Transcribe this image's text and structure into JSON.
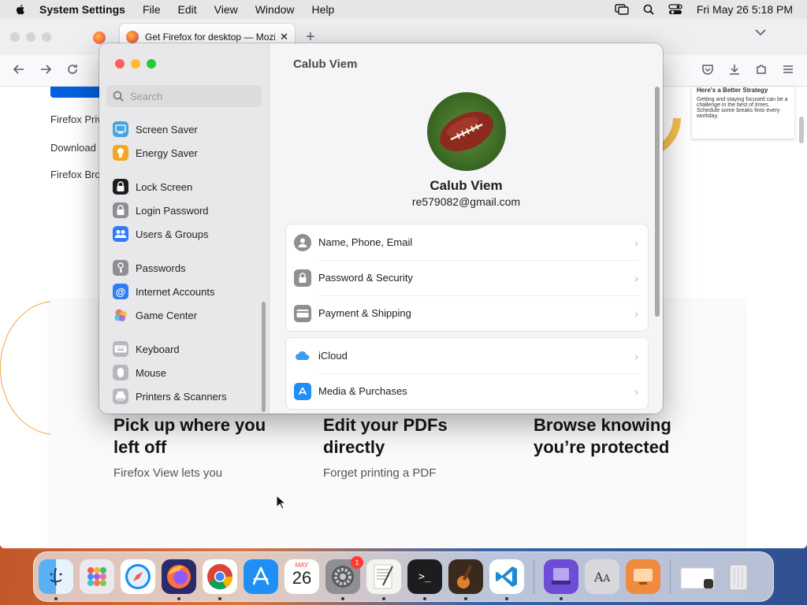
{
  "menubar": {
    "app_name": "System Settings",
    "menus": [
      "File",
      "Edit",
      "View",
      "Window",
      "Help"
    ],
    "datetime": "Fri May 26  5:18 PM"
  },
  "firefox": {
    "tab_title": "Get Firefox for desktop — Mozilla",
    "links": [
      "Firefox Priv",
      "Download",
      "Firefox Bro"
    ],
    "card": {
      "title": "Here's a Better Strategy",
      "body": "Getting and staying focused can be a challenge in the best of times. Schedule some breaks finto every workday."
    },
    "features": [
      {
        "title": "Pick up where you left off",
        "desc": "Firefox View lets you"
      },
      {
        "title": "Edit your PDFs directly",
        "desc": "Forget printing a PDF"
      },
      {
        "title": "Browse knowing you’re protected",
        "desc": ""
      }
    ]
  },
  "settings": {
    "search_placeholder": "Search",
    "sidebar": [
      {
        "label": "Screen Saver",
        "icon": "screen-saver-icon",
        "color": "#4aa3df"
      },
      {
        "label": "Energy Saver",
        "icon": "energy-saver-icon",
        "color": "#f5a623"
      },
      {
        "label": "Lock Screen",
        "icon": "lock-screen-icon",
        "color": "#1d1d1f"
      },
      {
        "label": "Login Password",
        "icon": "login-password-icon",
        "color": "#8e8e93"
      },
      {
        "label": "Users & Groups",
        "icon": "users-groups-icon",
        "color": "#2f7df6"
      },
      {
        "label": "Passwords",
        "icon": "passwords-icon",
        "color": "#8e8e93"
      },
      {
        "label": "Internet Accounts",
        "icon": "internet-accounts-icon",
        "color": "#2f7df6"
      },
      {
        "label": "Game Center",
        "icon": "game-center-icon",
        "color": "#ffffff"
      },
      {
        "label": "Keyboard",
        "icon": "keyboard-icon",
        "color": "#b8b8bc"
      },
      {
        "label": "Mouse",
        "icon": "mouse-icon",
        "color": "#b8b8bc"
      },
      {
        "label": "Printers & Scanners",
        "icon": "printers-scanners-icon",
        "color": "#b8b8bc"
      }
    ],
    "title": "Calub Viem",
    "profile": {
      "name": "Calub Viem",
      "email": "re579082@gmail.com"
    },
    "group1": [
      {
        "label": "Name, Phone, Email",
        "icon": "person-icon",
        "color": "#8e8e93"
      },
      {
        "label": "Password & Security",
        "icon": "lock-icon",
        "color": "#8e8e93"
      },
      {
        "label": "Payment & Shipping",
        "icon": "credit-card-icon",
        "color": "#8e8e93"
      }
    ],
    "group2": [
      {
        "label": "iCloud",
        "icon": "icloud-icon",
        "color": "#3d9df3"
      },
      {
        "label": "Media & Purchases",
        "icon": "app-store-icon",
        "color": "#1f8ef5"
      }
    ]
  },
  "dock": {
    "calendar_month": "MAY",
    "calendar_day": "26",
    "settings_badge": "1"
  }
}
